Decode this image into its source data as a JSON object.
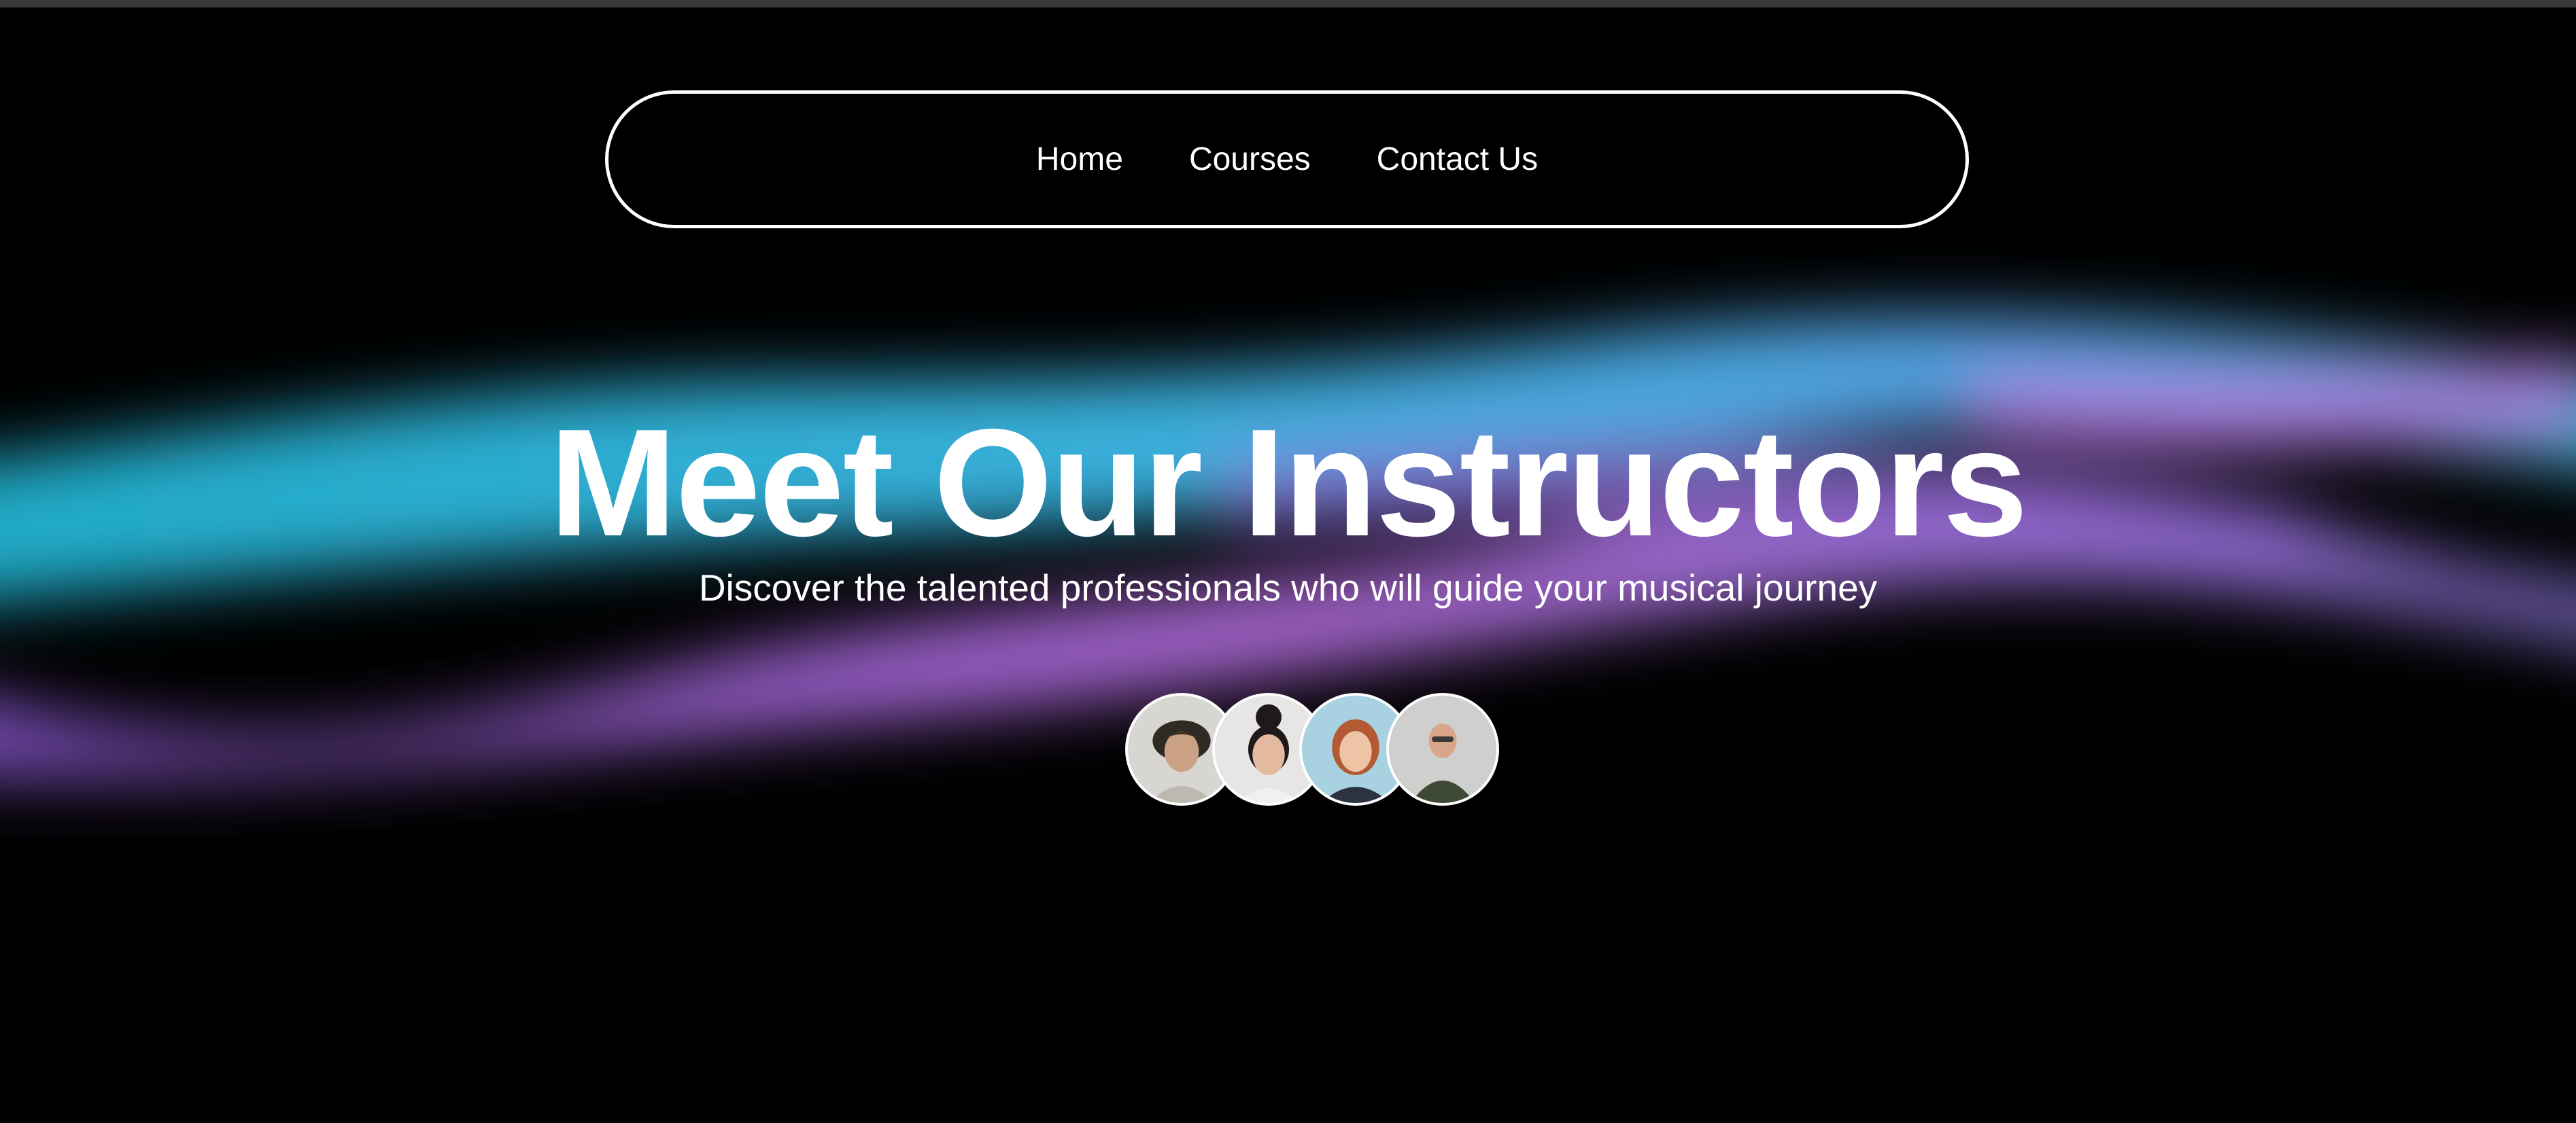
{
  "nav": {
    "items": [
      {
        "label": "Home"
      },
      {
        "label": "Courses"
      },
      {
        "label": "Contact Us"
      }
    ]
  },
  "hero": {
    "title": "Meet Our Instructors",
    "subtitle": "Discover the talented professionals who will guide your musical journey"
  },
  "avatars": [
    {
      "icon": "instructor-avatar-1"
    },
    {
      "icon": "instructor-avatar-2"
    },
    {
      "icon": "instructor-avatar-3"
    },
    {
      "icon": "instructor-avatar-4"
    }
  ],
  "colors": {
    "background": "#000000",
    "text": "#ffffff",
    "ribbon_cyan": "#22b8d8",
    "ribbon_blue": "#5aaaf0",
    "ribbon_purple": "#b070e0"
  }
}
